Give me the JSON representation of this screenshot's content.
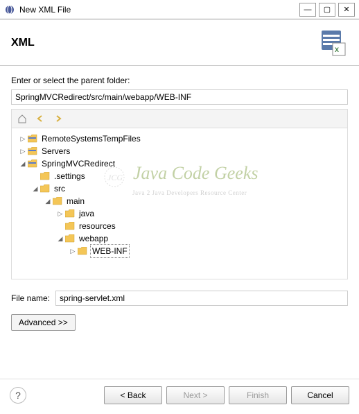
{
  "window": {
    "title": "New XML File"
  },
  "header": {
    "title": "XML"
  },
  "parent_folder": {
    "label": "Enter or select the parent folder:",
    "value": "SpringMVCRedirect/src/main/webapp/WEB-INF"
  },
  "tree": {
    "items": [
      {
        "indent": 0,
        "expander": "▷",
        "icon": "project",
        "label": "RemoteSystemsTempFiles"
      },
      {
        "indent": 0,
        "expander": "▷",
        "icon": "project",
        "label": "Servers"
      },
      {
        "indent": 0,
        "expander": "◢",
        "icon": "project",
        "label": "SpringMVCRedirect"
      },
      {
        "indent": 1,
        "expander": "",
        "icon": "folder",
        "label": ".settings"
      },
      {
        "indent": 1,
        "expander": "◢",
        "icon": "folder",
        "label": "src"
      },
      {
        "indent": 2,
        "expander": "◢",
        "icon": "folder",
        "label": "main"
      },
      {
        "indent": 3,
        "expander": "▷",
        "icon": "folder",
        "label": "java"
      },
      {
        "indent": 3,
        "expander": "",
        "icon": "folder",
        "label": "resources"
      },
      {
        "indent": 3,
        "expander": "◢",
        "icon": "folder",
        "label": "webapp"
      },
      {
        "indent": 4,
        "expander": "▷",
        "icon": "folder",
        "label": "WEB-INF",
        "selected": true
      }
    ]
  },
  "filename": {
    "label": "File name:",
    "value": "spring-servlet.xml"
  },
  "buttons": {
    "advanced": "Advanced >>",
    "back": "< Back",
    "next": "Next >",
    "finish": "Finish",
    "cancel": "Cancel"
  },
  "watermark": {
    "text": "Java Code Geeks",
    "sub": "Java 2 Java Developers Resource Center"
  }
}
